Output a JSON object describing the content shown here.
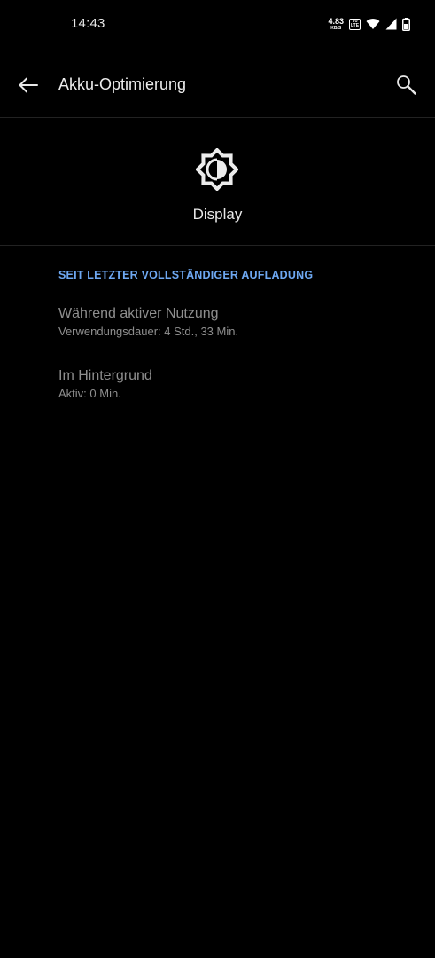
{
  "status_bar": {
    "time": "14:43",
    "net_speed_value": "4.83",
    "net_speed_unit": "KB/S",
    "volte_top": "Vo",
    "volte_bottom": "LTE"
  },
  "app_bar": {
    "title": "Akku-Optimierung"
  },
  "header": {
    "app_name": "Display"
  },
  "usage": {
    "category": "SEIT LETZTER VOLLSTÄNDIGER AUFLADUNG",
    "items": [
      {
        "title": "Während aktiver Nutzung",
        "summary": "Verwendungsdauer: 4 Std., 33 Min."
      },
      {
        "title": "Im Hintergrund",
        "summary": "Aktiv: 0 Min."
      }
    ]
  },
  "colors": {
    "background": "#000000",
    "accent": "#6ea8f2",
    "primary_text": "#e8e8e8",
    "disabled_text": "#8e8e8e",
    "divider": "#222222"
  },
  "icons": {
    "back": "arrow-left-icon",
    "search": "search-icon",
    "app": "brightness-icon"
  }
}
